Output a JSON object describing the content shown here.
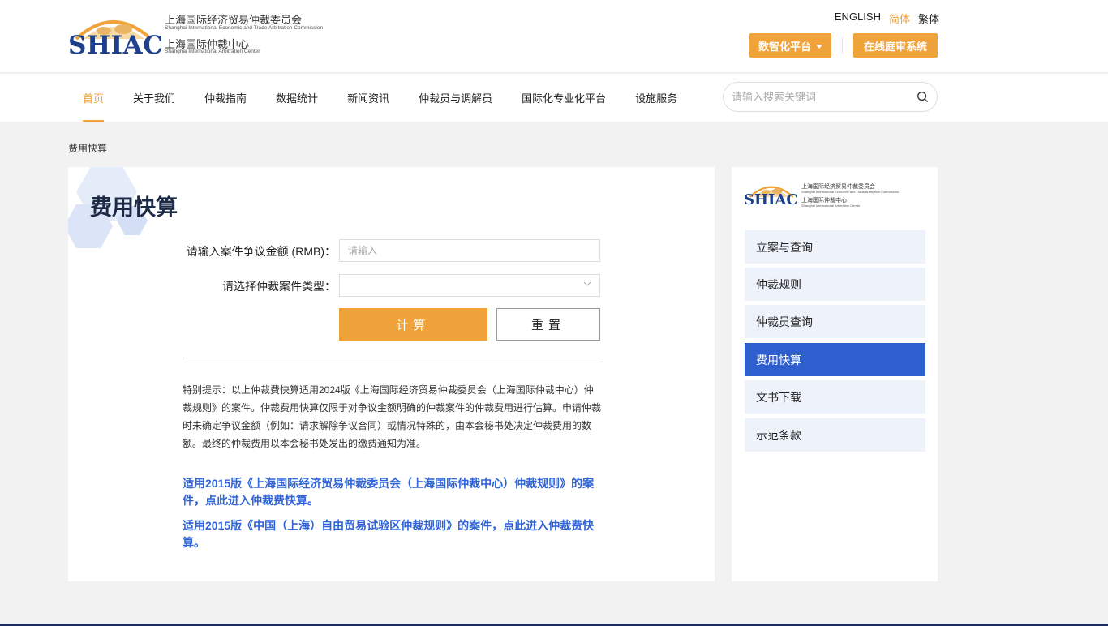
{
  "header": {
    "logo": {
      "brand": "SHIAC",
      "cn_line1": "上海国际经济贸易仲裁委员会",
      "en_line1": "Shanghai International Economic and Trade Arbitration Commission",
      "cn_line2": "上海国际仲裁中心",
      "en_line2": "Shanghai International Arbitration Center"
    },
    "languages": [
      "ENGLISH",
      "简体",
      "繁体"
    ],
    "active_language": "简体",
    "platform_button": "数智化平台",
    "online_button": "在线庭审系统"
  },
  "nav": {
    "items": [
      "首页",
      "关于我们",
      "仲裁指南",
      "数据统计",
      "新闻资讯",
      "仲裁员与调解员",
      "国际化专业化平台",
      "设施服务"
    ],
    "active": "首页",
    "search_placeholder": "请输入搜索关键词"
  },
  "breadcrumb": "费用快算",
  "main": {
    "title": "费用快算",
    "amount_label": "请输入案件争议金额 (RMB)：",
    "amount_placeholder": "请输入",
    "amount_value": "",
    "type_label": "请选择仲裁案件类型：",
    "type_value": "",
    "calc_button": "计算",
    "reset_button": "重置",
    "notice": "特别提示：以上仲裁费快算适用2024版《上海国际经济贸易仲裁委员会（上海国际仲裁中心）仲裁规则》的案件。仲裁费用快算仅限于对争议金额明确的仲裁案件的仲裁费用进行估算。申请仲裁时未确定争议金额（例如：请求解除争议合同）或情况特殊的，由本会秘书处决定仲裁费用的数额。最终的仲裁费用以本会秘书处发出的缴费通知为准。",
    "link1": "适用2015版《上海国际经济贸易仲裁委员会（上海国际仲裁中心）仲裁规则》的案件，点此进入仲裁费快算。",
    "link2": "适用2015版《中国（上海）自由贸易试验区仲裁规则》的案件，点此进入仲裁费快算。"
  },
  "sidebar": {
    "logo": {
      "brand": "SHIAC",
      "cn_line1": "上海国际经济贸易仲裁委员会",
      "en_line1": "Shanghai International Economic and Trade Arbitration Commission",
      "cn_line2": "上海国际仲裁中心",
      "en_line2": "Shanghai International Arbitration Center"
    },
    "items": [
      "立案与查询",
      "仲裁规则",
      "仲裁员查询",
      "费用快算",
      "文书下载",
      "示范条款"
    ],
    "active": "费用快算"
  },
  "colors": {
    "accent_orange": "#f0a33a",
    "brand_blue": "#1d3f8c",
    "link_blue": "#2f63d8",
    "active_blue": "#2f5fcf"
  }
}
